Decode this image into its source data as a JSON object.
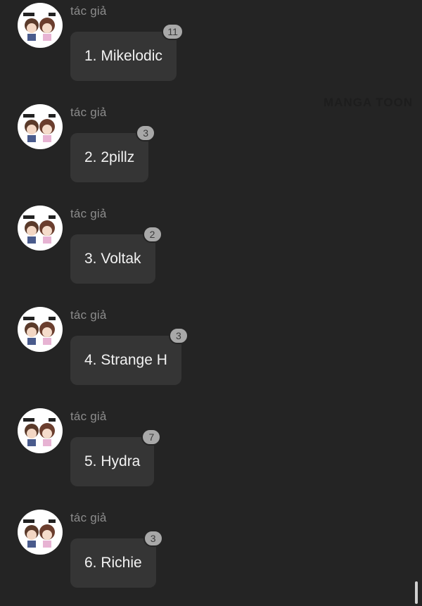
{
  "watermark": "MANGA TOON",
  "messages": [
    {
      "sender": "tác giả",
      "text": "1. Mikelodic",
      "reactions": "11"
    },
    {
      "sender": "tác giả",
      "text": "2. 2pillz",
      "reactions": "3"
    },
    {
      "sender": "tác giả",
      "text": "3. Voltak",
      "reactions": "2"
    },
    {
      "sender": "tác giả",
      "text": "4. Strange H",
      "reactions": "3"
    },
    {
      "sender": "tác giả",
      "text": "5. Hydra",
      "reactions": "7"
    },
    {
      "sender": "tác giả",
      "text": "6. Richie",
      "reactions": "3"
    }
  ],
  "colors": {
    "background": "#242424",
    "bubble": "#353535",
    "badge": "#a8a8a8",
    "sender_text": "#8c8c8c"
  }
}
